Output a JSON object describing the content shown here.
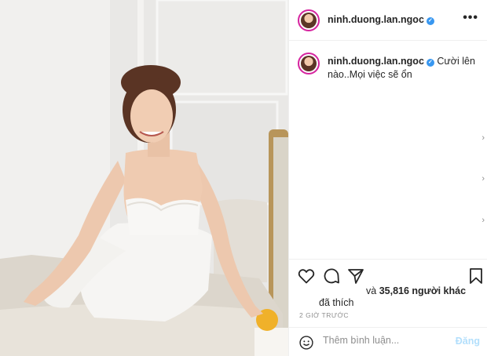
{
  "post": {
    "username": "ninh.duong.lan.ngoc",
    "verified_mark": "✓",
    "more_label": "•••",
    "caption": "Cười lên nào..Mọi việc sẽ ổn",
    "likes_prefix": "và",
    "likes_count": "35,816 người khác",
    "likes_suffix": "đã thích",
    "time": "2 GIỜ TRƯỚC",
    "chevron": "›"
  },
  "comment": {
    "placeholder": "Thêm bình luận...",
    "post_label": "Đăng"
  },
  "colors": {
    "verified": "#3897f0",
    "post_button": "#b2dffc",
    "avatar_ring": "#d6249f"
  },
  "icons": [
    "heart-icon",
    "comment-icon",
    "share-icon",
    "bookmark-icon",
    "more-options-icon",
    "emoji-icon",
    "verified-badge-icon",
    "chevron-right-icon"
  ]
}
